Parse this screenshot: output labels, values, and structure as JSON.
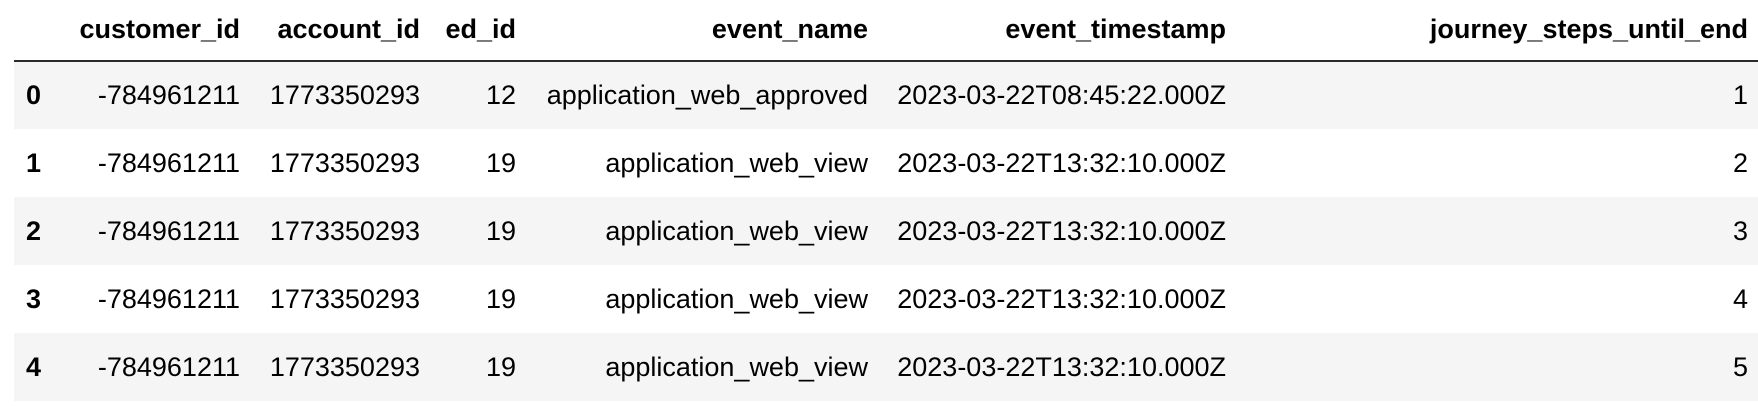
{
  "table": {
    "columns": [
      "",
      "customer_id",
      "account_id",
      "ed_id",
      "event_name",
      "event_timestamp",
      "journey_steps_until_end"
    ],
    "rows": [
      {
        "index": "0",
        "customer_id": "-784961211",
        "account_id": "1773350293",
        "ed_id": "12",
        "event_name": "application_web_approved",
        "event_timestamp": "2023-03-22T08:45:22.000Z",
        "journey_steps_until_end": "1"
      },
      {
        "index": "1",
        "customer_id": "-784961211",
        "account_id": "1773350293",
        "ed_id": "19",
        "event_name": "application_web_view",
        "event_timestamp": "2023-03-22T13:32:10.000Z",
        "journey_steps_until_end": "2"
      },
      {
        "index": "2",
        "customer_id": "-784961211",
        "account_id": "1773350293",
        "ed_id": "19",
        "event_name": "application_web_view",
        "event_timestamp": "2023-03-22T13:32:10.000Z",
        "journey_steps_until_end": "3"
      },
      {
        "index": "3",
        "customer_id": "-784961211",
        "account_id": "1773350293",
        "ed_id": "19",
        "event_name": "application_web_view",
        "event_timestamp": "2023-03-22T13:32:10.000Z",
        "journey_steps_until_end": "4"
      },
      {
        "index": "4",
        "customer_id": "-784961211",
        "account_id": "1773350293",
        "ed_id": "19",
        "event_name": "application_web_view",
        "event_timestamp": "2023-03-22T13:32:10.000Z",
        "journey_steps_until_end": "5"
      }
    ]
  },
  "colors": {
    "row_stripe": "#f5f5f5",
    "header_rule": "#2b2b2b",
    "text": "#000000"
  }
}
